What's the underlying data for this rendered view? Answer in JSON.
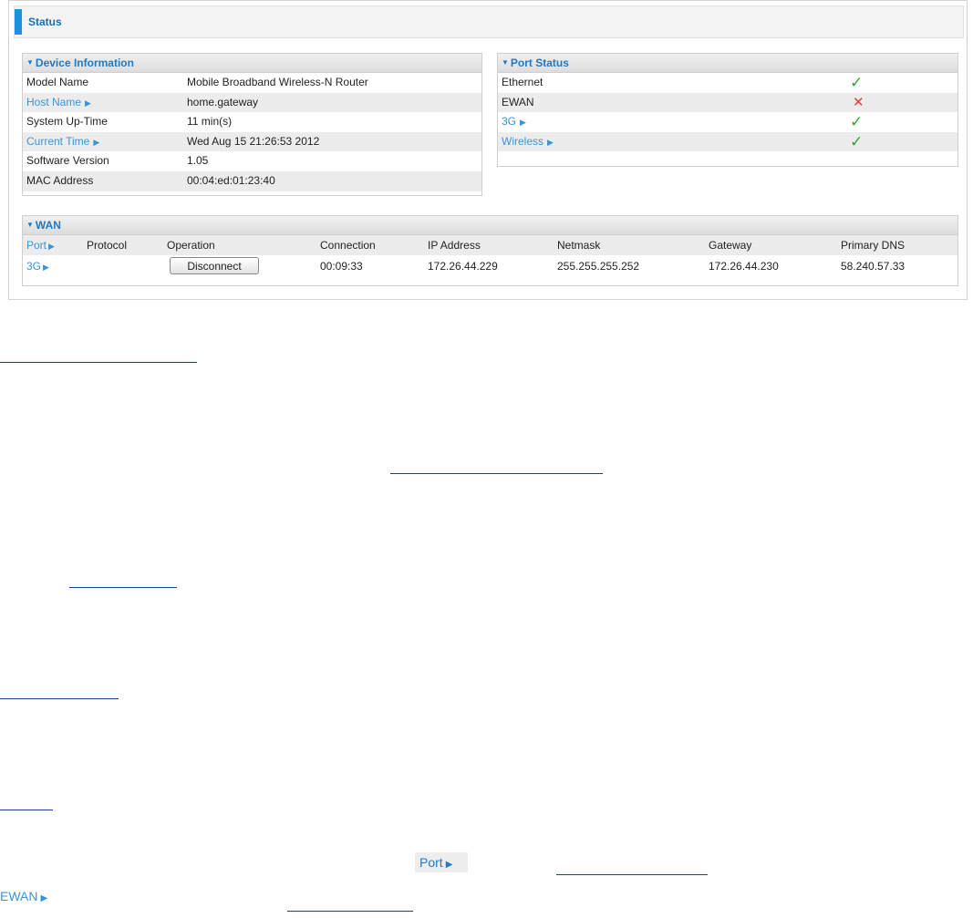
{
  "status": {
    "title": "Status"
  },
  "device_info": {
    "title": "Device Information",
    "rows": [
      {
        "label": "Model Name",
        "value": "Mobile Broadband Wireless-N Router",
        "link": false
      },
      {
        "label": "Host Name",
        "value": "home.gateway",
        "link": true
      },
      {
        "label": "System Up-Time",
        "value": "11 min(s)",
        "link": false
      },
      {
        "label": "Current Time",
        "value": "Wed Aug 15 21:26:53 2012",
        "link": true
      },
      {
        "label": "Software Version",
        "value": "1.05",
        "link": false
      },
      {
        "label": "MAC Address",
        "value": "00:04:ed:01:23:40",
        "link": false
      }
    ]
  },
  "port_status": {
    "title": "Port Status",
    "rows": [
      {
        "label": "Ethernet",
        "state": "up",
        "link": false
      },
      {
        "label": "EWAN",
        "state": "down",
        "link": false
      },
      {
        "label": "3G",
        "state": "up",
        "link": true
      },
      {
        "label": "Wireless",
        "state": "up",
        "link": true
      }
    ]
  },
  "wan": {
    "title": "WAN",
    "headers": [
      "Port",
      "Protocol",
      "Operation",
      "Connection",
      "IP Address",
      "Netmask",
      "Gateway",
      "Primary DNS"
    ],
    "row": {
      "port": "3G",
      "protocol": "",
      "operation_label": "Disconnect",
      "connection": "00:09:33",
      "ip": "172.26.44.229",
      "netmask": "255.255.255.252",
      "gateway": "172.26.44.230",
      "dns": "58.240.57.33"
    }
  },
  "doc": {
    "port_chip": "Port",
    "ewan_label": "EWAN"
  },
  "colors": {
    "accent": "#1e90e0",
    "link": "#3a95d8",
    "ok": "#2fa82f",
    "error": "#e23a3a"
  }
}
